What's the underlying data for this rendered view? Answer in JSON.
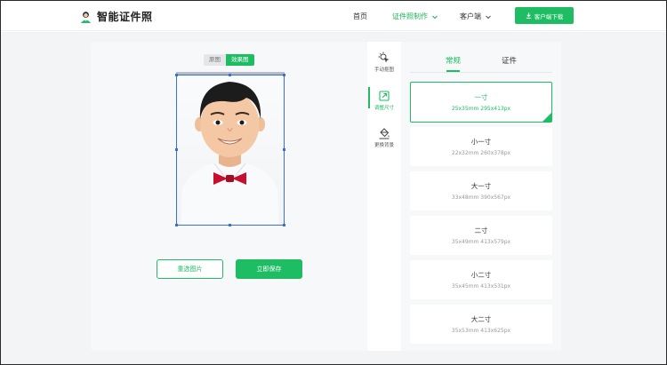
{
  "header": {
    "logo_text": "智能证件照",
    "nav": [
      {
        "label": "首页"
      },
      {
        "label": "证件照制作"
      },
      {
        "label": "客户端"
      }
    ],
    "download_label": "客户端下载"
  },
  "canvas": {
    "toggle": [
      {
        "label": "原图"
      },
      {
        "label": "效果图"
      }
    ],
    "reselect_label": "重选图片",
    "save_label": "立即保存"
  },
  "tools": [
    {
      "label": "手动抠图",
      "icon": "cursor-click-icon"
    },
    {
      "label": "调整尺寸",
      "icon": "resize-icon"
    },
    {
      "label": "更换背景",
      "icon": "paint-bucket-icon"
    }
  ],
  "sizes": {
    "tabs": [
      {
        "label": "常规"
      },
      {
        "label": "证件"
      }
    ],
    "items": [
      {
        "name": "一寸",
        "dims": "25x35mm 295x413px"
      },
      {
        "name": "小一寸",
        "dims": "22x32mm 260x378px"
      },
      {
        "name": "大一寸",
        "dims": "33x48mm 390x567px"
      },
      {
        "name": "二寸",
        "dims": "35x49mm 413x579px"
      },
      {
        "name": "小二寸",
        "dims": "35x45mm 413x531px"
      },
      {
        "name": "大二寸",
        "dims": "35x53mm 413x625px"
      }
    ]
  },
  "colors": {
    "accent": "#1ebd63",
    "crop_border": "#3b6fd6",
    "tie": "#c8102e"
  }
}
